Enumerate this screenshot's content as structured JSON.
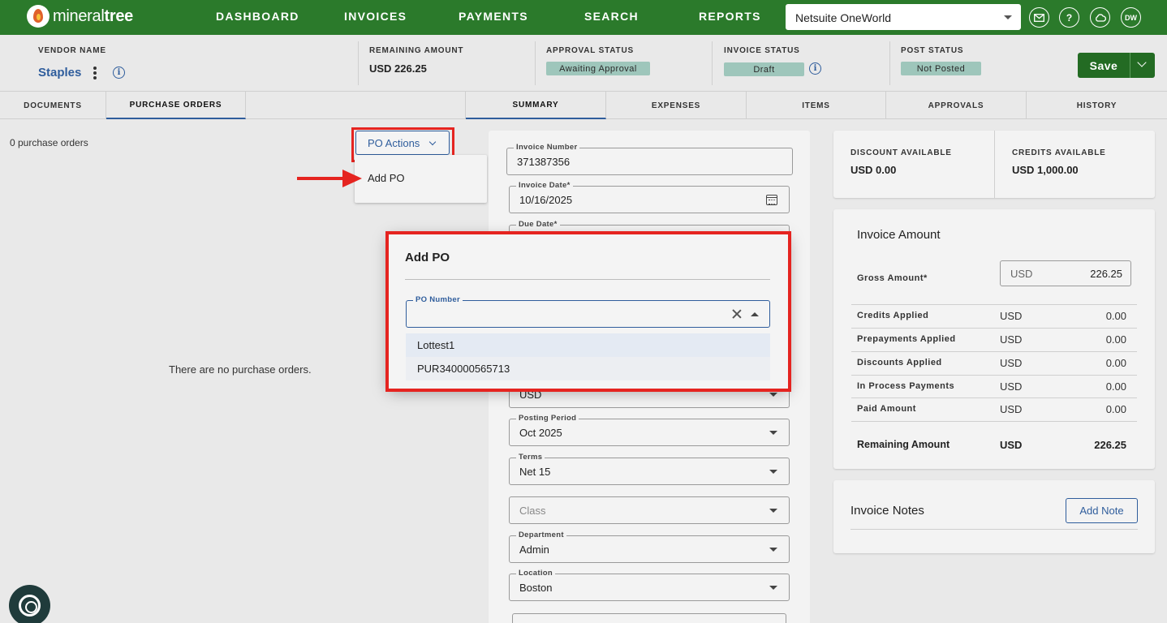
{
  "nav": {
    "logo_text_light": "mineral",
    "logo_text_bold": "tree",
    "links": [
      "DASHBOARD",
      "INVOICES",
      "PAYMENTS",
      "SEARCH",
      "REPORTS"
    ],
    "org": "Netsuite OneWorld",
    "user_initials": "DW"
  },
  "header": {
    "vendor_label": "VENDOR NAME",
    "vendor_name": "Staples",
    "remaining_label": "REMAINING AMOUNT",
    "remaining_value": "USD  226.25",
    "approval_label": "APPROVAL STATUS",
    "approval_value": "Awaiting Approval",
    "invoice_status_label": "INVOICE STATUS",
    "invoice_status_value": "Draft",
    "post_status_label": "POST STATUS",
    "post_status_value": "Not Posted",
    "save_label": "Save"
  },
  "tabs": {
    "left": [
      "DOCUMENTS",
      "PURCHASE ORDERS"
    ],
    "right": [
      "SUMMARY",
      "EXPENSES",
      "ITEMS",
      "APPROVALS",
      "HISTORY"
    ]
  },
  "po_panel": {
    "count": "0 purchase orders",
    "actions_label": "PO Actions",
    "menu_item": "Add PO",
    "empty_message": "There are no purchase orders."
  },
  "form": {
    "invoice_number_label": "Invoice Number",
    "invoice_number": "371387356",
    "invoice_date_label": "Invoice Date*",
    "invoice_date": "10/16/2025",
    "due_date_label": "Due Date*",
    "currency": "USD",
    "posting_period_label": "Posting Period",
    "posting_period": "Oct 2025",
    "terms_label": "Terms",
    "terms": "Net 15",
    "class_placeholder": "Class",
    "department_label": "Department",
    "department": "Admin",
    "location_label": "Location",
    "location": "Boston"
  },
  "credits": {
    "discount_label": "DISCOUNT AVAILABLE",
    "discount_value": "USD  0.00",
    "credits_label": "CREDITS AVAILABLE",
    "credits_value": "USD  1,000.00"
  },
  "invoice_amount": {
    "title": "Invoice Amount",
    "gross_label": "Gross Amount*",
    "gross_currency": "USD",
    "gross_value": "226.25",
    "rows": [
      {
        "label": "Credits Applied",
        "currency": "USD",
        "value": "0.00"
      },
      {
        "label": "Prepayments Applied",
        "currency": "USD",
        "value": "0.00"
      },
      {
        "label": "Discounts Applied",
        "currency": "USD",
        "value": "0.00"
      },
      {
        "label": "In Process Payments",
        "currency": "USD",
        "value": "0.00"
      },
      {
        "label": "Paid Amount",
        "currency": "USD",
        "value": "0.00"
      }
    ],
    "remaining_label": "Remaining Amount",
    "remaining_currency": "USD",
    "remaining_value": "226.25"
  },
  "notes": {
    "title": "Invoice Notes",
    "add_label": "Add Note"
  },
  "modal": {
    "title": "Add PO",
    "field_label": "PO Number",
    "options": [
      "Lottest1",
      "PUR340000565713"
    ]
  },
  "colors": {
    "nav_green": "#2b7a2b",
    "accent_blue": "#2f5d9c",
    "highlight_red": "#e52420",
    "status_pill": "#9ec6bb"
  }
}
